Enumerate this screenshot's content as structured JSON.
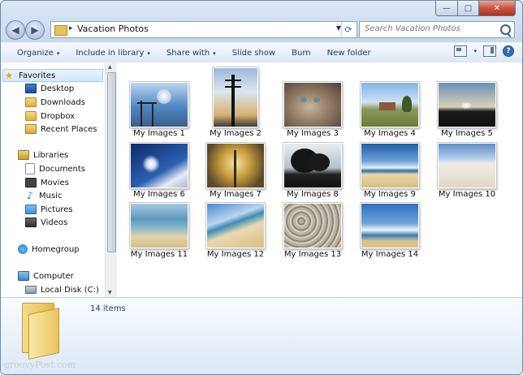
{
  "window": {
    "caption_buttons": {
      "minimize": "—",
      "maximize": "□",
      "close": "✕"
    }
  },
  "navigation": {
    "back_glyph": "◀",
    "forward_glyph": "▶",
    "address_arrow": "▸",
    "address": "Vacation Photos",
    "search_placeholder": "Search Vacation Photos"
  },
  "toolbar": {
    "items": [
      {
        "label": "Organize",
        "dropdown": true
      },
      {
        "label": "Include in library",
        "dropdown": true
      },
      {
        "label": "Share with",
        "dropdown": true
      },
      {
        "label": "Slide show",
        "dropdown": false
      },
      {
        "label": "Burn",
        "dropdown": false
      },
      {
        "label": "New folder",
        "dropdown": false
      }
    ],
    "caret": "▾",
    "help_label": "?"
  },
  "nav_pane": {
    "favorites": {
      "label": "Favorites",
      "items": [
        "Desktop",
        "Downloads",
        "Dropbox",
        "Recent Places"
      ]
    },
    "libraries": {
      "label": "Libraries",
      "items": [
        "Documents",
        "Movies",
        "Music",
        "Pictures",
        "Videos"
      ]
    },
    "homegroup": "Homegroup",
    "computer": {
      "label": "Computer",
      "items": [
        "Local Disk (C:)"
      ]
    }
  },
  "files": [
    {
      "name": "My Images 1"
    },
    {
      "name": "My Images 2"
    },
    {
      "name": "My Images 3"
    },
    {
      "name": "My Images 4"
    },
    {
      "name": "My Images 5"
    },
    {
      "name": "My Images 6"
    },
    {
      "name": "My Images 7"
    },
    {
      "name": "My Images 8"
    },
    {
      "name": "My Images 9"
    },
    {
      "name": "My Images 10"
    },
    {
      "name": "My Images 11"
    },
    {
      "name": "My Images 12"
    },
    {
      "name": "My Images 13"
    },
    {
      "name": "My Images 14"
    }
  ],
  "status": {
    "item_count": "14 items"
  },
  "watermark": "groovyPost.com"
}
